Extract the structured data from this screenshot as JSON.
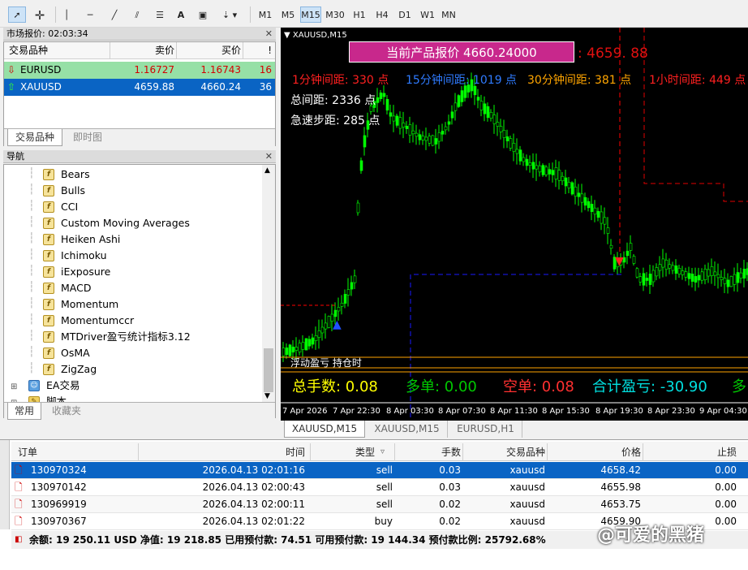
{
  "toolbar": {
    "timeframes": [
      "M1",
      "M5",
      "M15",
      "M30",
      "H1",
      "H4",
      "D1",
      "W1",
      "MN"
    ]
  },
  "market_watch": {
    "title": "市场报价: 02:03:34",
    "columns": {
      "symbol": "交易品种",
      "bid": "卖价",
      "ask": "买价",
      "spread": "!"
    },
    "rows": [
      {
        "symbol": "EURUSD",
        "bid": "1.16727",
        "ask": "1.16743",
        "spread": "16"
      },
      {
        "symbol": "XAUUSD",
        "bid": "4659.88",
        "ask": "4660.24",
        "spread": "36"
      }
    ],
    "tabs": [
      "交易品种",
      "即时图"
    ]
  },
  "navigator": {
    "title": "导航",
    "items": [
      "Bears",
      "Bulls",
      "CCI",
      "Custom Moving Averages",
      "Heiken Ashi",
      "Ichimoku",
      "iExposure",
      "MACD",
      "Momentum",
      "Momentumccr",
      "MTDriver盈亏统计指标3.12",
      "OsMA",
      "ZigZag"
    ],
    "folders": [
      "EA交易",
      "脚本"
    ],
    "tabs": [
      "常用",
      "收藏夹"
    ]
  },
  "chart": {
    "title": "XAUUSD,M15",
    "price_box": "当前产品报价  4660.24000",
    "price_side": ": 4659. 88",
    "dist_1m": "1分钟间距: 330 点",
    "dist_15m": "15分钟间距: 1019 点",
    "dist_30m": "30分钟间距: 381 点",
    "dist_1h": "1小时间距: 449 点",
    "total_dist": "总间距: 2336 点",
    "fast_dist": "急速步距: 285 点",
    "overlap_text": "浮动盈亏 持仓时",
    "total_lots": "总手数: 0.08",
    "long_lots": "多单: 0.00",
    "short_lots": "空单: 0.08",
    "total_pl": "合计盈亏: -30.90",
    "more": "多",
    "x_ticks": [
      "7 Apr 2026",
      "7 Apr 22:30",
      "8 Apr 03:30",
      "8 Apr 07:30",
      "8 Apr 11:30",
      "8 Apr 15:30",
      "8 Apr 19:30",
      "8 Apr 23:30",
      "9 Apr 04:30"
    ],
    "tabs": [
      "XAUUSD,M15",
      "XAUUSD,M15",
      "EURUSD,H1"
    ],
    "colors": {
      "up": "#00ff00",
      "red_line": "#ff0000",
      "blue_line": "#0000ff",
      "orange": "#ffa500",
      "magenta": "#c8288c"
    }
  },
  "orders": {
    "columns": {
      "order": "订单",
      "time": "时间",
      "type": "类型",
      "lots": "手数",
      "symbol": "交易品种",
      "price": "价格",
      "sl": "止损"
    },
    "rows": [
      {
        "order": "130970324",
        "time": "2026.04.13 02:01:16",
        "type": "sell",
        "lots": "0.03",
        "symbol": "xauusd",
        "price": "4658.42",
        "sl": "0.00"
      },
      {
        "order": "130970142",
        "time": "2026.04.13 02:00:43",
        "type": "sell",
        "lots": "0.03",
        "symbol": "xauusd",
        "price": "4655.98",
        "sl": "0.00"
      },
      {
        "order": "130969919",
        "time": "2026.04.13 02:00:11",
        "type": "sell",
        "lots": "0.02",
        "symbol": "xauusd",
        "price": "4653.75",
        "sl": "0.00"
      },
      {
        "order": "130970367",
        "time": "2026.04.13 02:01:22",
        "type": "buy",
        "lots": "0.02",
        "symbol": "xauusd",
        "price": "4659.90",
        "sl": "0.00"
      }
    ],
    "summary": "余额: 19 250.11 USD  净值: 19 218.85  已用预付款: 74.51  可用预付款: 19 144.34  预付款比例: 25792.68%"
  },
  "watermark": "@可爱的黑猪"
}
